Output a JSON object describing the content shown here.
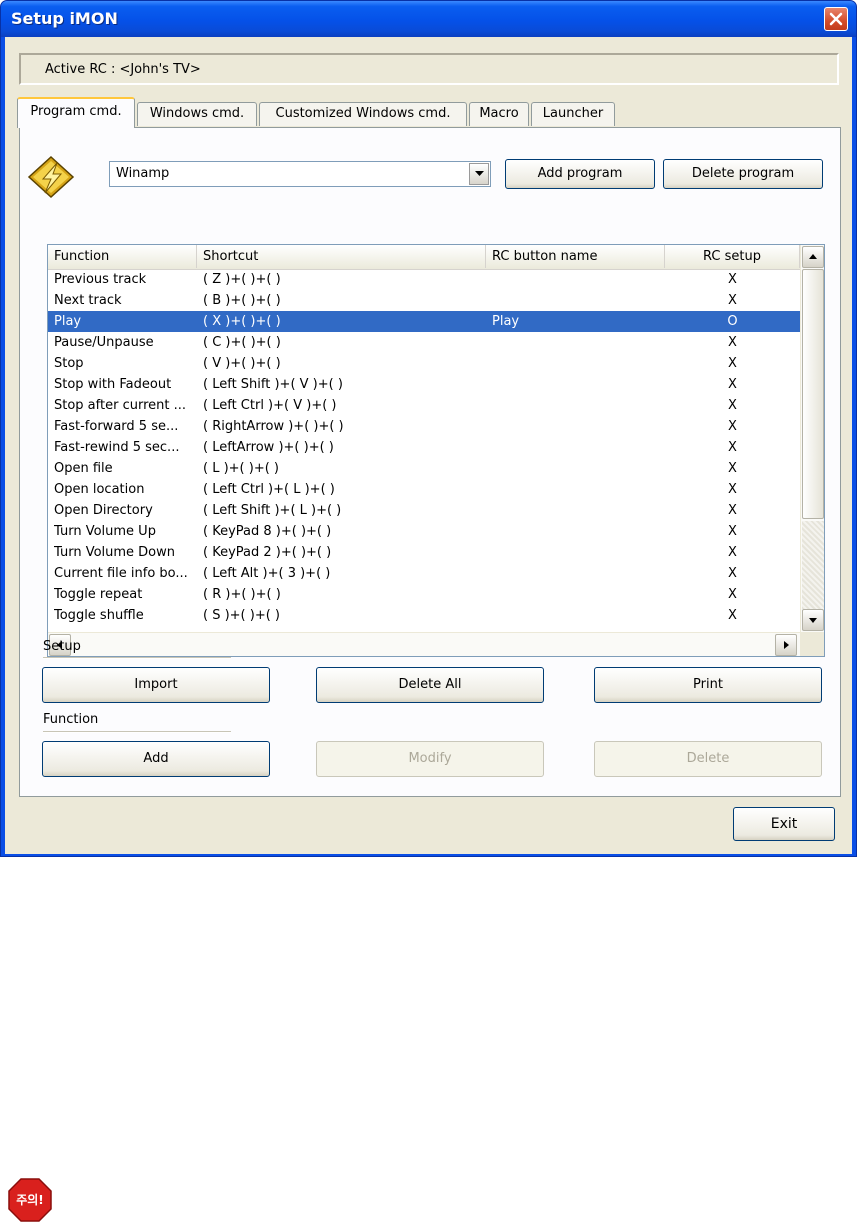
{
  "window": {
    "title": "Setup iMON"
  },
  "active_rc": {
    "label": "Active RC : <John's TV>"
  },
  "tabs": [
    {
      "label": "Program cmd.",
      "active": true
    },
    {
      "label": "Windows cmd.",
      "active": false
    },
    {
      "label": "Customized Windows cmd.",
      "active": false
    },
    {
      "label": "Macro",
      "active": false
    },
    {
      "label": "Launcher",
      "active": false
    }
  ],
  "program": {
    "selected": "Winamp",
    "add_label": "Add program",
    "delete_label": "Delete program"
  },
  "table": {
    "columns": [
      "Function",
      "Shortcut",
      "RC button name",
      "RC setup"
    ],
    "rows": [
      [
        "Previous track",
        "( Z )+(  )+(  )",
        "",
        "X"
      ],
      [
        "Next track",
        "( B )+(  )+(  )",
        "",
        "X"
      ],
      [
        "Play",
        "( X )+(  )+(  )",
        "Play",
        "O"
      ],
      [
        "Pause/Unpause",
        "( C )+(  )+(  )",
        "",
        "X"
      ],
      [
        "Stop",
        "( V )+(  )+(  )",
        "",
        "X"
      ],
      [
        "Stop with Fadeout",
        "( Left Shift )+( V )+(  )",
        "",
        "X"
      ],
      [
        "Stop after current ...",
        "( Left Ctrl )+( V )+(  )",
        "",
        "X"
      ],
      [
        "Fast-forward 5 se...",
        "( RightArrow )+(  )+(  )",
        "",
        "X"
      ],
      [
        "Fast-rewind 5 sec...",
        "( LeftArrow )+(  )+(  )",
        "",
        "X"
      ],
      [
        "Open file",
        "( L )+(  )+(  )",
        "",
        "X"
      ],
      [
        "Open location",
        "( Left Ctrl )+( L )+(  )",
        "",
        "X"
      ],
      [
        "Open Directory",
        "( Left Shift )+( L )+(  )",
        "",
        "X"
      ],
      [
        "Turn Volume Up",
        "( KeyPad 8 )+(  )+(  )",
        "",
        "X"
      ],
      [
        "Turn Volume Down",
        "( KeyPad 2 )+(  )+(  )",
        "",
        "X"
      ],
      [
        "Current file info bo...",
        "( Left Alt )+( 3 )+(  )",
        "",
        "X"
      ],
      [
        "Toggle repeat",
        "( R )+(  )+(  )",
        "",
        "X"
      ],
      [
        "Toggle shuffle",
        "( S )+(  )+(  )",
        "",
        "X"
      ]
    ],
    "selected_index": 2
  },
  "setup": {
    "label": "Setup",
    "import_label": "Import",
    "delete_all_label": "Delete All",
    "print_label": "Print"
  },
  "function": {
    "label": "Function",
    "add_label": "Add",
    "modify_label": "Modify",
    "delete_label": "Delete"
  },
  "exit_label": "Exit",
  "warning_badge": "주의!",
  "colors": {
    "titlebar": "#0a5ef0",
    "selection": "#316ac5",
    "dialog_bg": "#ece9d8",
    "warning_red": "#d9201d"
  }
}
